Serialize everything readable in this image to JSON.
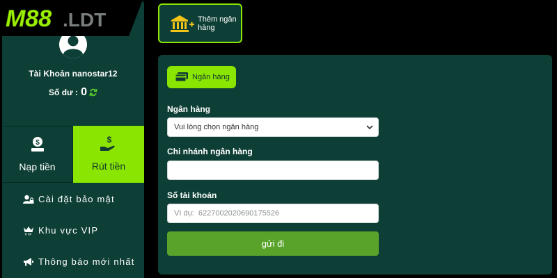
{
  "logo": {
    "main": "M88",
    "suffix": ".LDT"
  },
  "profile": {
    "username": "Tài Khoản nanostar12",
    "balance_label": "Số dư :",
    "balance_value": "0"
  },
  "actions": {
    "deposit_label": "Nạp tiền",
    "withdraw_label": "Rút tiền"
  },
  "menu": [
    {
      "label": "Cài đặt bảo mật",
      "icon": "user-lock-icon"
    },
    {
      "label": "Khu vực VIP",
      "icon": "vip-crown-icon"
    },
    {
      "label": "Thông báo mới nhất",
      "icon": "megaphone-icon"
    }
  ],
  "add_bank": {
    "label": "Thêm ngân hàng",
    "icon": "bank-plus-icon"
  },
  "panel": {
    "tab_label": "Ngân hàng",
    "fields": {
      "bank": {
        "label": "Ngân hàng",
        "value": "Vui lòng chọn ngân hàng"
      },
      "branch": {
        "label": "Chi nhánh ngân hàng",
        "value": ""
      },
      "account": {
        "label": "Số tài khoản",
        "placeholder": "Ví dụ:  6227002020690175526"
      }
    },
    "submit_label": "gửi đi"
  },
  "colors": {
    "accent": "#8ae500",
    "panel": "#0e3f36",
    "submit": "#59a32b",
    "background": "#000000"
  }
}
